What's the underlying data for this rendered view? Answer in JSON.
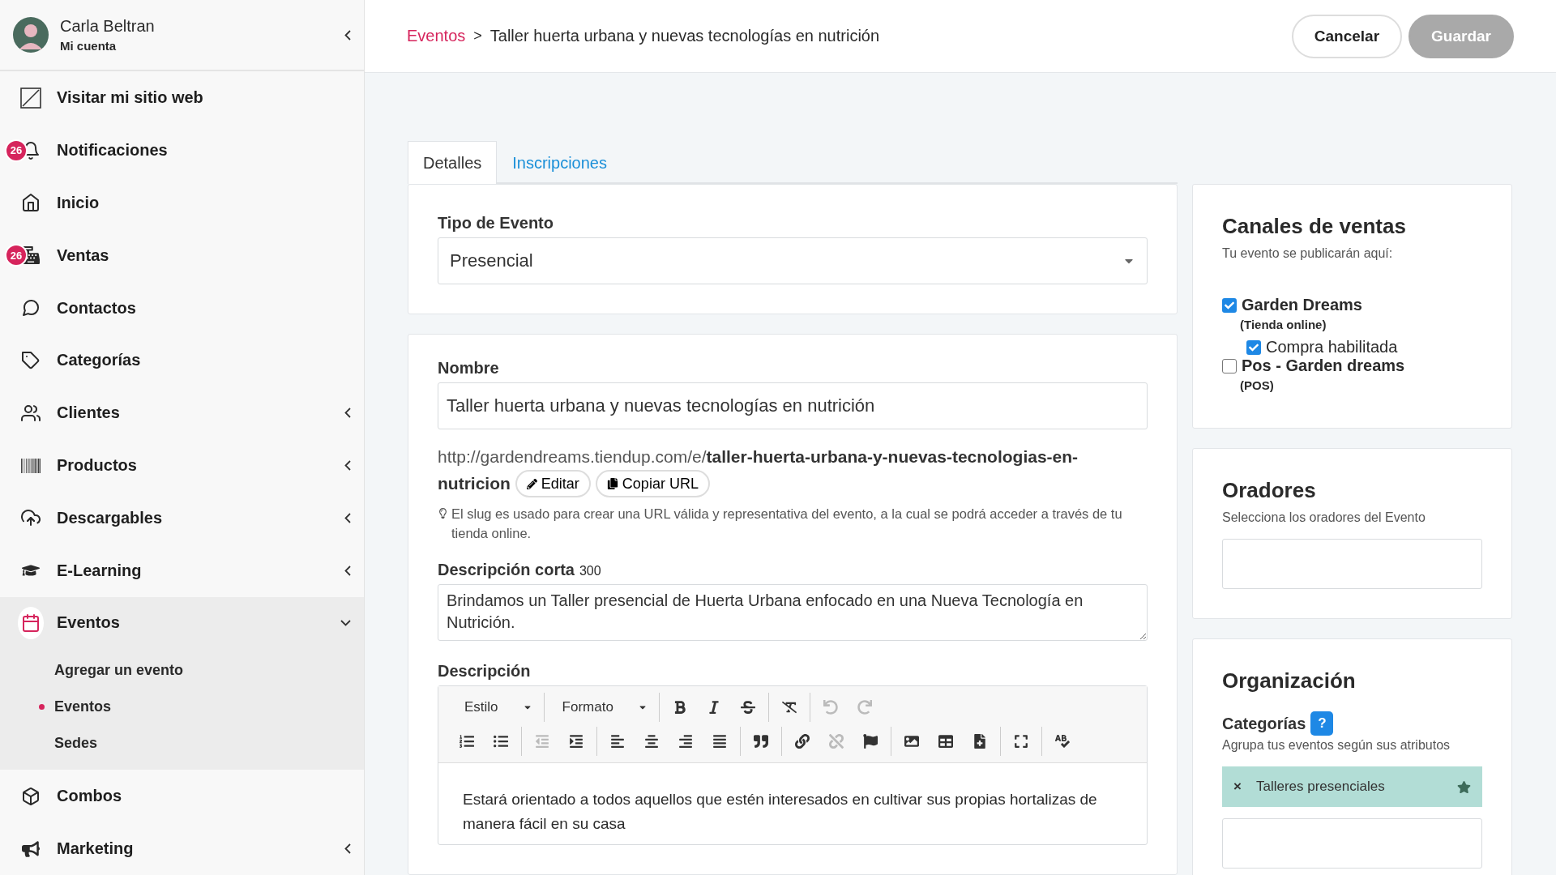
{
  "sidebar": {
    "user": {
      "name": "Carla Beltran",
      "subtitle": "Mi cuenta",
      "collapsed": true
    },
    "items": [
      {
        "kind": "site",
        "label": "Visitar mi sitio web",
        "submenu": false,
        "expanded": false,
        "selected": false
      },
      {
        "kind": "bell",
        "label": "Notificaciones",
        "badge": "26",
        "submenu": false,
        "expanded": false,
        "selected": false
      },
      {
        "kind": "home",
        "label": "Inicio",
        "submenu": false,
        "expanded": false,
        "selected": false
      },
      {
        "kind": "register",
        "label": "Ventas",
        "badge": "26",
        "submenu": false,
        "expanded": false,
        "selected": false
      },
      {
        "kind": "chat",
        "label": "Contactos",
        "submenu": false,
        "expanded": false,
        "selected": false
      },
      {
        "kind": "tag",
        "label": "Categorías",
        "submenu": false,
        "expanded": false,
        "selected": false
      },
      {
        "kind": "users",
        "label": "Clientes",
        "submenu": true,
        "expanded": false,
        "selected": false
      },
      {
        "kind": "barcode",
        "label": "Productos",
        "submenu": true,
        "expanded": false,
        "selected": false
      },
      {
        "kind": "cloud",
        "label": "Descargables",
        "submenu": true,
        "expanded": false,
        "selected": false
      },
      {
        "kind": "cap",
        "label": "E-Learning",
        "submenu": true,
        "expanded": false,
        "selected": false
      },
      {
        "kind": "calendar",
        "label": "Eventos",
        "submenu": true,
        "expanded": true,
        "selected": true,
        "children": [
          {
            "label": "Agregar un evento",
            "selected": false
          },
          {
            "label": "Eventos",
            "selected": true
          },
          {
            "label": "Sedes",
            "selected": false
          }
        ]
      },
      {
        "kind": "box",
        "label": "Combos",
        "submenu": false,
        "expanded": false,
        "selected": false
      },
      {
        "kind": "megaphone",
        "label": "Marketing",
        "submenu": true,
        "expanded": false,
        "selected": false
      }
    ]
  },
  "header": {
    "breadcrumb": {
      "parent": "Eventos",
      "separator": ">",
      "current": "Taller huerta urbana y nuevas tecnologías en nutrición"
    },
    "buttons": [
      {
        "label": "Cancelar",
        "kind": "outline",
        "disabled": false
      },
      {
        "label": "Guardar",
        "kind": "primary",
        "disabled": true
      }
    ]
  },
  "tabs": [
    {
      "label": "Detalles",
      "selected": true
    },
    {
      "label": "Inscripciones",
      "selected": false
    }
  ],
  "event_type": {
    "label": "Tipo de Evento",
    "value": "Presencial"
  },
  "name": {
    "label": "Nombre",
    "value": "Taller huerta urbana y nuevas tecnologías en nutrición"
  },
  "url": {
    "lines": [
      "http://gardendreams.tiendup.com/e/**taller-huerta-urbana-y-nuevas-tecnologias-en-**",
      "**nutricion**"
    ],
    "buttons": [
      {
        "kind": "edit",
        "label": "Editar"
      },
      {
        "kind": "copy",
        "label": "Copiar URL"
      }
    ],
    "hint": "El slug es usado para crear una URL válida y representativa del evento, a la cual se podrá acceder a través de tu tienda online."
  },
  "short_description": {
    "label": "Descripción corta",
    "counter": "300",
    "value": "Brindamos un Taller presencial de Huerta Urbana enfocado en una Nueva Tecnología en Nutrición."
  },
  "description": {
    "label": "Descripción",
    "toolbar": [
      {
        "groups": [
          {
            "items": [
              {
                "kind": "dropdown",
                "label": "Estilo"
              }
            ]
          },
          {
            "items": [
              {
                "kind": "dropdown",
                "label": "Formato"
              }
            ]
          },
          {
            "items": [
              {
                "kind": "bold",
                "disabled": false
              },
              {
                "kind": "italic",
                "disabled": false
              },
              {
                "kind": "strike",
                "disabled": false
              }
            ]
          },
          {
            "items": [
              {
                "kind": "clear",
                "disabled": false
              }
            ]
          },
          {
            "items": [
              {
                "kind": "undo",
                "disabled": true
              },
              {
                "kind": "redo",
                "disabled": true
              }
            ]
          }
        ]
      },
      {
        "groups": [
          {
            "items": [
              {
                "kind": "ol",
                "disabled": false
              },
              {
                "kind": "ul",
                "disabled": false
              }
            ]
          },
          {
            "items": [
              {
                "kind": "outdent",
                "disabled": true
              },
              {
                "kind": "indent",
                "disabled": false
              }
            ]
          },
          {
            "items": [
              {
                "kind": "left",
                "disabled": false
              },
              {
                "kind": "center",
                "disabled": false
              },
              {
                "kind": "right",
                "disabled": false
              },
              {
                "kind": "justify",
                "disabled": false
              }
            ]
          },
          {
            "items": [
              {
                "kind": "quote",
                "disabled": false
              }
            ]
          },
          {
            "items": [
              {
                "kind": "link",
                "disabled": false
              },
              {
                "kind": "unlink",
                "disabled": true
              },
              {
                "kind": "flag",
                "disabled": false
              }
            ]
          },
          {
            "items": [
              {
                "kind": "image",
                "disabled": false
              },
              {
                "kind": "table",
                "disabled": false
              },
              {
                "kind": "template",
                "disabled": false
              }
            ]
          },
          {
            "items": [
              {
                "kind": "maximize",
                "disabled": false
              }
            ]
          },
          {
            "items": [
              {
                "kind": "spell",
                "disabled": false
              }
            ]
          }
        ]
      }
    ],
    "text": "Estará orientado a todos aquellos que estén interesados en cultivar sus propias hortalizas de manera fácil en su casa"
  },
  "channels": {
    "title": "Canales de ventas",
    "subtitle": "Tu evento se publicarán aquí:",
    "items": [
      {
        "name": "Garden Dreams",
        "type": "(Tienda online)",
        "checked": true,
        "children": [
          {
            "label": "Compra habilitada",
            "checked": true
          }
        ]
      },
      {
        "name": "Pos - Garden dreams",
        "type": "(POS)",
        "checked": false
      }
    ]
  },
  "speakers": {
    "title": "Oradores",
    "subtitle": "Selecciona los oradores del Evento"
  },
  "organization": {
    "title": "Organización",
    "categories": {
      "label": "Categorías",
      "help": "?",
      "subtitle": "Agrupa tus eventos según sus atributos",
      "tags": [
        {
          "label": "Talleres presenciales",
          "remove": "×",
          "featured": true
        }
      ]
    }
  }
}
